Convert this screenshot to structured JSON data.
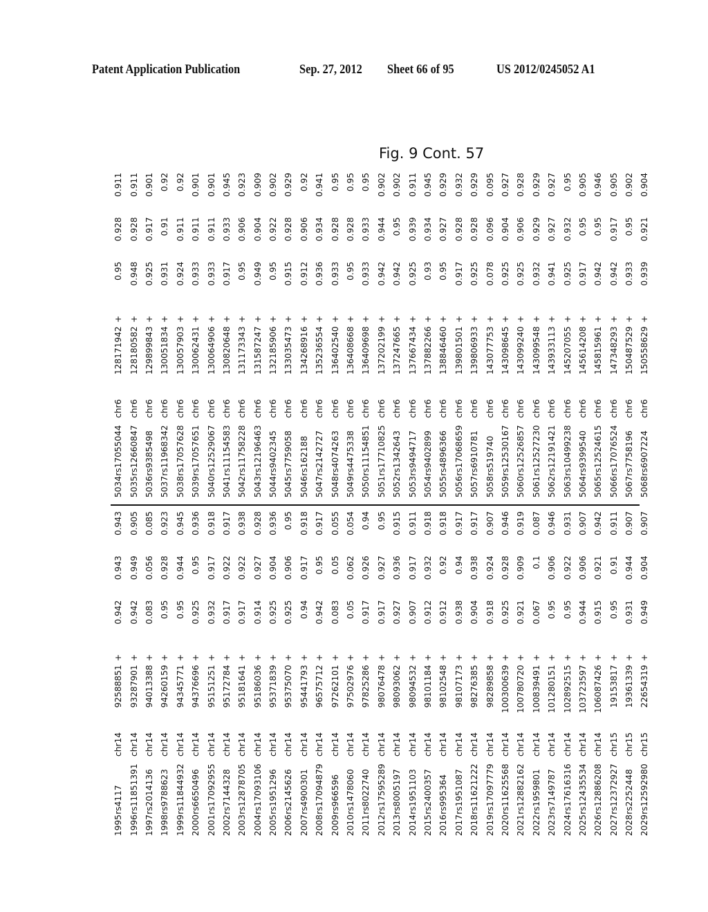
{
  "header": {
    "publication": "Patent Application Publication",
    "date": "Sep. 27, 2012",
    "sheet": "Sheet 66 of 95",
    "number": "US 2012/0245052 A1"
  },
  "figure_label": "Fig. 9  Cont. 57",
  "left_rows": [
    [
      "1995",
      "rs4117",
      "chr14",
      "92588851",
      "+",
      "0.942",
      "0.943",
      "0.943"
    ],
    [
      "1996",
      "rs11851391",
      "chr14",
      "93287901",
      "+",
      "0.942",
      "0.949",
      "0.905"
    ],
    [
      "1997",
      "rs2014136",
      "chr14",
      "94013388",
      "+",
      "0.083",
      "0.056",
      "0.085"
    ],
    [
      "1998",
      "rs9788623",
      "chr14",
      "94260159",
      "+",
      "0.95",
      "0.928",
      "0.923"
    ],
    [
      "1999",
      "rs11844932",
      "chr14",
      "94345771",
      "+",
      "0.95",
      "0.944",
      "0.945"
    ],
    [
      "2000",
      "rs6650496",
      "chr14",
      "94376696",
      "+",
      "0.925",
      "0.95",
      "0.936"
    ],
    [
      "2001",
      "rs17092955",
      "chr14",
      "95151251",
      "+",
      "0.932",
      "0.917",
      "0.918"
    ],
    [
      "2002",
      "rs7144328",
      "chr14",
      "95172784",
      "+",
      "0.917",
      "0.922",
      "0.917"
    ],
    [
      "2003",
      "rs12878705",
      "chr14",
      "95181641",
      "+",
      "0.917",
      "0.922",
      "0.938"
    ],
    [
      "2004",
      "rs17093106",
      "chr14",
      "95186036",
      "+",
      "0.914",
      "0.927",
      "0.928"
    ],
    [
      "2005",
      "rs1951296",
      "chr14",
      "95371839",
      "+",
      "0.925",
      "0.904",
      "0.936"
    ],
    [
      "2006",
      "rs2145626",
      "chr14",
      "95375070",
      "+",
      "0.925",
      "0.906",
      "0.95"
    ],
    [
      "2007",
      "rs4900301",
      "chr14",
      "95441793",
      "+",
      "0.94",
      "0.917",
      "0.918"
    ],
    [
      "2008",
      "rs17094879",
      "chr14",
      "96575712",
      "+",
      "0.942",
      "0.95",
      "0.917"
    ],
    [
      "2009",
      "rs966596",
      "chr14",
      "97262101",
      "+",
      "0.083",
      "0.05",
      "0.055"
    ],
    [
      "2010",
      "rs1478060",
      "chr14",
      "97502976",
      "+",
      "0.05",
      "0.062",
      "0.054"
    ],
    [
      "2011",
      "rs8022740",
      "chr14",
      "97825286",
      "+",
      "0.917",
      "0.926",
      "0.94"
    ],
    [
      "2012",
      "rs17595289",
      "chr14",
      "98076478",
      "+",
      "0.917",
      "0.927",
      "0.95"
    ],
    [
      "2013",
      "rs8005197",
      "chr14",
      "98093062",
      "+",
      "0.927",
      "0.936",
      "0.915"
    ],
    [
      "2014",
      "rs1951103",
      "chr14",
      "98094532",
      "+",
      "0.907",
      "0.917",
      "0.911"
    ],
    [
      "2015",
      "rs2400357",
      "chr14",
      "98101184",
      "+",
      "0.912",
      "0.932",
      "0.918"
    ],
    [
      "2016",
      "rs995364",
      "chr14",
      "98102548",
      "+",
      "0.912",
      "0.92",
      "0.918"
    ],
    [
      "2017",
      "rs1951087",
      "chr14",
      "98107173",
      "+",
      "0.938",
      "0.94",
      "0.917"
    ],
    [
      "2018",
      "rs11621222",
      "chr14",
      "98276385",
      "+",
      "0.904",
      "0.938",
      "0.917"
    ],
    [
      "2019",
      "rs17097779",
      "chr14",
      "98289858",
      "+",
      "0.918",
      "0.924",
      "0.907"
    ],
    [
      "2020",
      "rs11625568",
      "chr14",
      "100300639",
      "+",
      "0.925",
      "0.928",
      "0.946"
    ],
    [
      "2021",
      "rs12882162",
      "chr14",
      "100780720",
      "+",
      "0.921",
      "0.909",
      "0.919"
    ],
    [
      "2022",
      "rs1959801",
      "chr14",
      "100839491",
      "+",
      "0.067",
      "0.1",
      "0.087"
    ],
    [
      "2023",
      "rs7149787",
      "chr14",
      "101280151",
      "+",
      "0.95",
      "0.906",
      "0.946"
    ],
    [
      "2024",
      "rs17616316",
      "chr14",
      "102892515",
      "+",
      "0.95",
      "0.922",
      "0.931"
    ],
    [
      "2025",
      "rs12435534",
      "chr14",
      "103723597",
      "+",
      "0.944",
      "0.906",
      "0.907"
    ],
    [
      "2026",
      "rs12886208",
      "chr14",
      "106087426",
      "+",
      "0.915",
      "0.921",
      "0.942"
    ],
    [
      "2027",
      "rs12372927",
      "chr15",
      "19153817",
      "+",
      "0.95",
      "0.91",
      "0.911"
    ],
    [
      "2028",
      "rs2252448",
      "chr15",
      "19361339",
      "+",
      "0.931",
      "0.944",
      "0.907"
    ],
    [
      "2029",
      "rs12592980",
      "chr15",
      "22654319",
      "+",
      "0.949",
      "0.904",
      "0.907"
    ]
  ],
  "right_rows": [
    [
      "5034",
      "rs17055044",
      "chr6",
      "128171942",
      "+",
      "0.95",
      "0.928",
      "0.911"
    ],
    [
      "5035",
      "rs12660847",
      "chr6",
      "128180582",
      "+",
      "0.948",
      "0.928",
      "0.911"
    ],
    [
      "5036",
      "rs9385498",
      "chr6",
      "129899843",
      "+",
      "0.925",
      "0.917",
      "0.901"
    ],
    [
      "5037",
      "rs11968342",
      "chr6",
      "130051834",
      "+",
      "0.931",
      "0.91",
      "0.92"
    ],
    [
      "5038",
      "rs17057628",
      "chr6",
      "130057903",
      "+",
      "0.924",
      "0.911",
      "0.92"
    ],
    [
      "5039",
      "rs17057651",
      "chr6",
      "130062431",
      "+",
      "0.933",
      "0.911",
      "0.901"
    ],
    [
      "5040",
      "rs12529067",
      "chr6",
      "130064906",
      "+",
      "0.933",
      "0.911",
      "0.901"
    ],
    [
      "5041",
      "rs11154583",
      "chr6",
      "130820648",
      "+",
      "0.917",
      "0.933",
      "0.945"
    ],
    [
      "5042",
      "rs11758228",
      "chr6",
      "131173343",
      "+",
      "0.95",
      "0.906",
      "0.923"
    ],
    [
      "5043",
      "rs12196463",
      "chr6",
      "131587247",
      "+",
      "0.949",
      "0.904",
      "0.909"
    ],
    [
      "5044",
      "rs9402345",
      "chr6",
      "132185906",
      "+",
      "0.95",
      "0.922",
      "0.902"
    ],
    [
      "5045",
      "rs7759058",
      "chr6",
      "133035473",
      "+",
      "0.915",
      "0.928",
      "0.929"
    ],
    [
      "5046",
      "rs162188",
      "chr6",
      "134268916",
      "+",
      "0.912",
      "0.906",
      "0.92"
    ],
    [
      "5047",
      "rs2142727",
      "chr6",
      "135236554",
      "+",
      "0.936",
      "0.934",
      "0.941"
    ],
    [
      "5048",
      "rs4074263",
      "chr6",
      "136402540",
      "+",
      "0.933",
      "0.928",
      "0.95"
    ],
    [
      "5049",
      "rs4475338",
      "chr6",
      "136408668",
      "+",
      "0.95",
      "0.928",
      "0.95"
    ],
    [
      "5050",
      "rs11154851",
      "chr6",
      "136409698",
      "+",
      "0.933",
      "0.933",
      "0.95"
    ],
    [
      "5051",
      "rs17710825",
      "chr6",
      "137202199",
      "+",
      "0.942",
      "0.944",
      "0.902"
    ],
    [
      "5052",
      "rs1342643",
      "chr6",
      "137247665",
      "+",
      "0.942",
      "0.95",
      "0.902"
    ],
    [
      "5053",
      "rs9494717",
      "chr6",
      "137667434",
      "+",
      "0.925",
      "0.939",
      "0.911"
    ],
    [
      "5054",
      "rs9402899",
      "chr6",
      "137882266",
      "+",
      "0.93",
      "0.934",
      "0.945"
    ],
    [
      "5055",
      "rs4896366",
      "chr6",
      "138846460",
      "+",
      "0.95",
      "0.927",
      "0.929"
    ],
    [
      "5056",
      "rs17068659",
      "chr6",
      "139801501",
      "+",
      "0.917",
      "0.928",
      "0.932"
    ],
    [
      "5057",
      "rs6910781",
      "chr6",
      "139806933",
      "+",
      "0.925",
      "0.928",
      "0.929"
    ],
    [
      "5058",
      "rs519740",
      "chr6",
      "143077753",
      "+",
      "0.078",
      "0.096",
      "0.095"
    ],
    [
      "5059",
      "rs12530167",
      "chr6",
      "143098645",
      "+",
      "0.925",
      "0.904",
      "0.927"
    ],
    [
      "5060",
      "rs12526857",
      "chr6",
      "143099240",
      "+",
      "0.925",
      "0.906",
      "0.928"
    ],
    [
      "5061",
      "rs12527230",
      "chr6",
      "143099548",
      "+",
      "0.932",
      "0.929",
      "0.929"
    ],
    [
      "5062",
      "rs12191421",
      "chr6",
      "143933113",
      "+",
      "0.941",
      "0.927",
      "0.927"
    ],
    [
      "5063",
      "rs10499238",
      "chr6",
      "145207055",
      "+",
      "0.925",
      "0.932",
      "0.95"
    ],
    [
      "5064",
      "rs9399540",
      "chr6",
      "145614208",
      "+",
      "0.917",
      "0.95",
      "0.905"
    ],
    [
      "5065",
      "rs12524615",
      "chr6",
      "145815961",
      "+",
      "0.942",
      "0.95",
      "0.946"
    ],
    [
      "5066",
      "rs17076524",
      "chr6",
      "147348293",
      "+",
      "0.942",
      "0.917",
      "0.905"
    ],
    [
      "5067",
      "rs7758196",
      "chr6",
      "150487529",
      "+",
      "0.933",
      "0.95",
      "0.902"
    ],
    [
      "5068",
      "rs6907224",
      "chr6",
      "150558629",
      "+",
      "0.939",
      "0.921",
      "0.904"
    ]
  ]
}
